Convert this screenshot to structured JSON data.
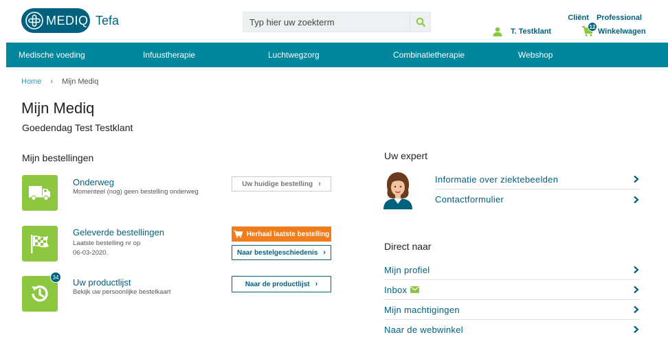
{
  "brand": {
    "name": "MEDIQ",
    "sub": "Tefa",
    "primary": "#00617e",
    "nav_bg": "#00879e",
    "accent_green": "#8dc63f",
    "accent_orange": "#f07c1b"
  },
  "search": {
    "placeholder": "Typ hier uw zoekterm"
  },
  "top_links": {
    "client": "Cliënt",
    "professional": "Professional"
  },
  "user": {
    "name": "T. Testklant"
  },
  "cart": {
    "label": "Winkelwagen",
    "count": "12"
  },
  "nav": [
    {
      "label": "Medische voeding"
    },
    {
      "label": "Infuustherapie"
    },
    {
      "label": "Luchtwegzorg"
    },
    {
      "label": "Combinatietherapie"
    },
    {
      "label": "Webshop"
    }
  ],
  "breadcrumb": {
    "home": "Home",
    "current": "Mijn Mediq"
  },
  "page": {
    "title": "Mijn Mediq",
    "greeting": "Goedendag Test Testklant"
  },
  "orders": {
    "title": "Mijn bestellingen",
    "items": [
      {
        "icon": "truck-icon",
        "title": "Onderweg",
        "desc": "Momenteel (nog) geen bestelling onderweg",
        "button": "Uw huidige bestelling"
      },
      {
        "icon": "checkered-flag-icon",
        "title": "Geleverde bestellingen",
        "desc_line1": "Laatste bestelling nr op",
        "desc_line2": "06-03-2020.",
        "button_primary": "Herhaal laatste bestelling",
        "button_secondary": "Naar bestelgeschiedenis"
      },
      {
        "icon": "history-icon",
        "title": "Uw productlijst",
        "desc": "Bekijk uw persoonlijke bestelkaart",
        "badge": "34",
        "button": "Naar de productlijst"
      }
    ]
  },
  "expert": {
    "title": "Uw expert",
    "links": [
      {
        "label": "Informatie over ziektebeelden"
      },
      {
        "label": "Contactformulier"
      }
    ]
  },
  "direct": {
    "title": "Direct naar",
    "links": [
      {
        "label": "Mijn profiel"
      },
      {
        "label": "Inbox",
        "icon": "mail-icon"
      },
      {
        "label": "Mijn machtigingen"
      },
      {
        "label": "Naar de webwinkel"
      }
    ]
  }
}
